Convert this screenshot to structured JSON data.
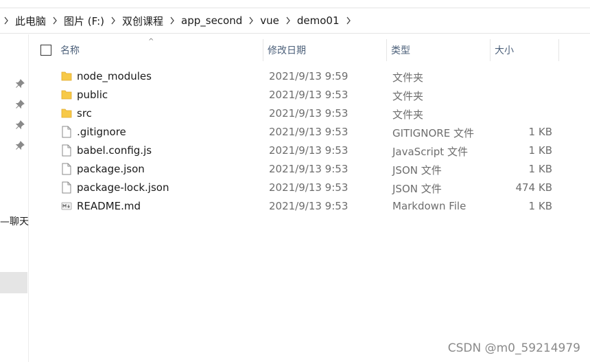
{
  "breadcrumb": {
    "items": [
      "此电脑",
      "图片 (F:)",
      "双创课程",
      "app_second",
      "vue",
      "demo01"
    ]
  },
  "quick_access": {
    "label_partial": "—聊天"
  },
  "columns": {
    "name": "名称",
    "modified": "修改日期",
    "type": "类型",
    "size": "大小"
  },
  "files": [
    {
      "name": "node_modules",
      "modified": "2021/9/13 9:59",
      "type": "文件夹",
      "size": "",
      "icon": "folder-icon"
    },
    {
      "name": "public",
      "modified": "2021/9/13 9:53",
      "type": "文件夹",
      "size": "",
      "icon": "folder-icon"
    },
    {
      "name": "src",
      "modified": "2021/9/13 9:53",
      "type": "文件夹",
      "size": "",
      "icon": "folder-icon"
    },
    {
      "name": ".gitignore",
      "modified": "2021/9/13 9:53",
      "type": "GITIGNORE 文件",
      "size": "1 KB",
      "icon": "file-icon"
    },
    {
      "name": "babel.config.js",
      "modified": "2021/9/13 9:53",
      "type": "JavaScript 文件",
      "size": "1 KB",
      "icon": "file-icon"
    },
    {
      "name": "package.json",
      "modified": "2021/9/13 9:53",
      "type": "JSON 文件",
      "size": "1 KB",
      "icon": "file-icon"
    },
    {
      "name": "package-lock.json",
      "modified": "2021/9/13 9:53",
      "type": "JSON 文件",
      "size": "474 KB",
      "icon": "file-icon"
    },
    {
      "name": "README.md",
      "modified": "2021/9/13 9:53",
      "type": "Markdown File",
      "size": "1 KB",
      "icon": "markdown-file-icon"
    }
  ],
  "watermark": "CSDN @m0_59214979",
  "colors": {
    "folder": "#f7c948",
    "header_text": "#4c607a",
    "secondary_text": "#6d6d6d"
  }
}
